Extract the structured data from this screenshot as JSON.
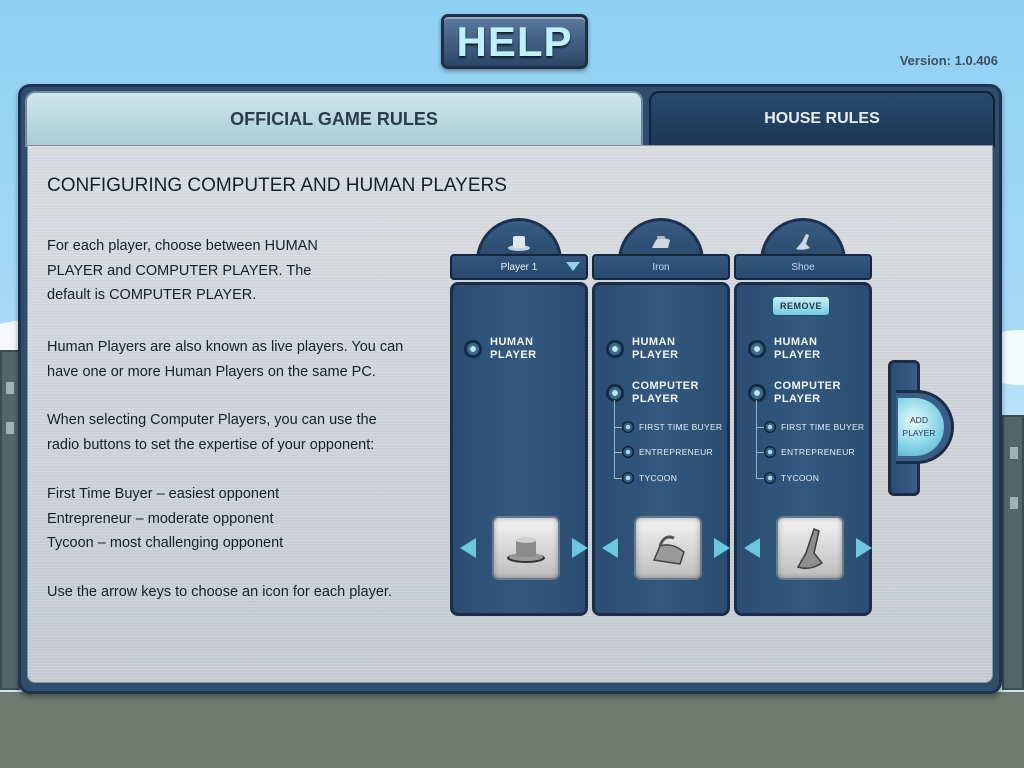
{
  "header": {
    "title": "HELP",
    "version": "Version: 1.0.406"
  },
  "tabs": [
    {
      "label": "OFFICIAL GAME RULES",
      "active": true
    },
    {
      "label": "HOUSE RULES",
      "active": false
    }
  ],
  "content": {
    "title": "CONFIGURING COMPUTER AND HUMAN PLAYERS",
    "paragraphs": [
      [
        "For each player, choose between HUMAN",
        "PLAYER and COMPUTER PLAYER.  The",
        "default is COMPUTER PLAYER."
      ],
      [
        "Human Players are also known as live players. You can",
        "have one or more Human Players on the same PC."
      ],
      [
        "When selecting Computer Players, you can use the",
        "radio buttons to set the expertise of your opponent:"
      ],
      [
        "First Time Buyer – easiest opponent",
        "Entrepreneur – moderate opponent",
        "Tycoon – most challenging opponent"
      ],
      [
        "Use the arrow keys to choose an icon for each player."
      ]
    ]
  },
  "labels": {
    "human": [
      "HUMAN",
      "PLAYER"
    ],
    "computer": [
      "COMPUTER",
      "PLAYER"
    ],
    "first_time_buyer": "FIRST TIME BUYER",
    "entrepreneur": "ENTREPRENEUR",
    "tycoon": "TYCOON",
    "remove": "REMOVE",
    "add_player": [
      "ADD",
      "PLAYER"
    ]
  },
  "players": [
    {
      "name": "Player 1",
      "token": "hat-icon",
      "type": "human",
      "has_dropdown": true
    },
    {
      "name": "Iron",
      "token": "iron-icon",
      "type": "computer",
      "expertise": "first_time_buyer"
    },
    {
      "name": "Shoe",
      "token": "shoe-icon",
      "type": "computer",
      "expertise": "entrepreneur",
      "removable": true
    }
  ],
  "colors": {
    "panel": "#2f4d6d",
    "accent": "#6cc8e0",
    "tab_active": "#bcdce2",
    "tab_inactive": "#234264"
  }
}
